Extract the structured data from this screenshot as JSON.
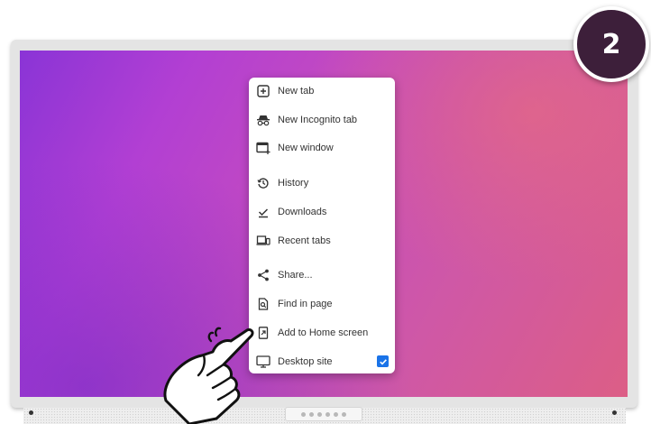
{
  "step_badge": "2",
  "menu": {
    "items": [
      {
        "label": "New tab",
        "icon": "new-tab-icon"
      },
      {
        "label": "New Incognito tab",
        "icon": "incognito-icon"
      },
      {
        "label": "New window",
        "icon": "new-window-icon"
      },
      {
        "label": "History",
        "icon": "history-icon"
      },
      {
        "label": "Downloads",
        "icon": "download-icon"
      },
      {
        "label": "Recent tabs",
        "icon": "devices-icon"
      },
      {
        "label": "Share...",
        "icon": "share-icon"
      },
      {
        "label": "Find in page",
        "icon": "find-icon"
      },
      {
        "label": "Add to Home screen",
        "icon": "add-to-home-icon"
      },
      {
        "label": "Desktop site",
        "icon": "desktop-icon",
        "checked": true
      }
    ]
  },
  "colors": {
    "badge": "#3d1f3a",
    "check": "#1a73e8",
    "wallpaper_start": "#8a34d6",
    "wallpaper_end": "#dc5e86"
  }
}
